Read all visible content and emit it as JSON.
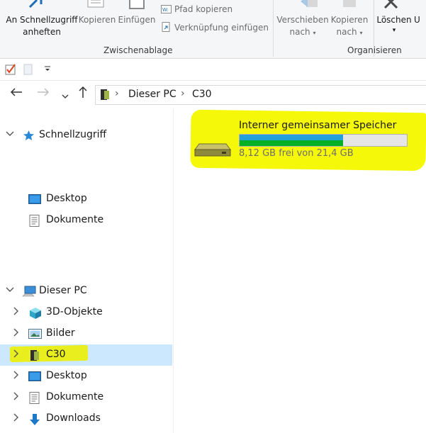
{
  "ribbon": {
    "pin_label_1": "An Schnellzugriff",
    "pin_label_2": "anheften",
    "copy_label": "Kopieren",
    "paste_label": "Einfügen",
    "copy_path_label": "Pfad kopieren",
    "paste_shortcut_label": "Verknüpfung einfügen",
    "clipboard_group": "Zwischenablage",
    "move_label_1": "Verschieben",
    "move_label_2": "nach",
    "copyto_label_1": "Kopieren",
    "copyto_label_2": "nach",
    "delete_label": "Löschen",
    "organize_group": "Organisieren"
  },
  "address": {
    "crumbs": [
      "Dieser PC",
      "C30"
    ]
  },
  "tree": {
    "quick_access": "Schnellzugriff",
    "desktop_qa": "Desktop",
    "documents_qa": "Dokumente",
    "this_pc": "Dieser PC",
    "objects3d": "3D-Objekte",
    "pictures": "Bilder",
    "c30": "C30",
    "desktop": "Desktop",
    "documents": "Dokumente",
    "downloads": "Downloads"
  },
  "drive": {
    "name": "Interner gemeinsamer Speicher",
    "free_text": "8,12 GB frei von 21,4 GB",
    "used_fraction": 0.62
  },
  "colors": {
    "highlight": "#f6f80a",
    "selection": "#cce8ff",
    "bar_fill": "#26a0da",
    "bar_green": "#06b025"
  }
}
